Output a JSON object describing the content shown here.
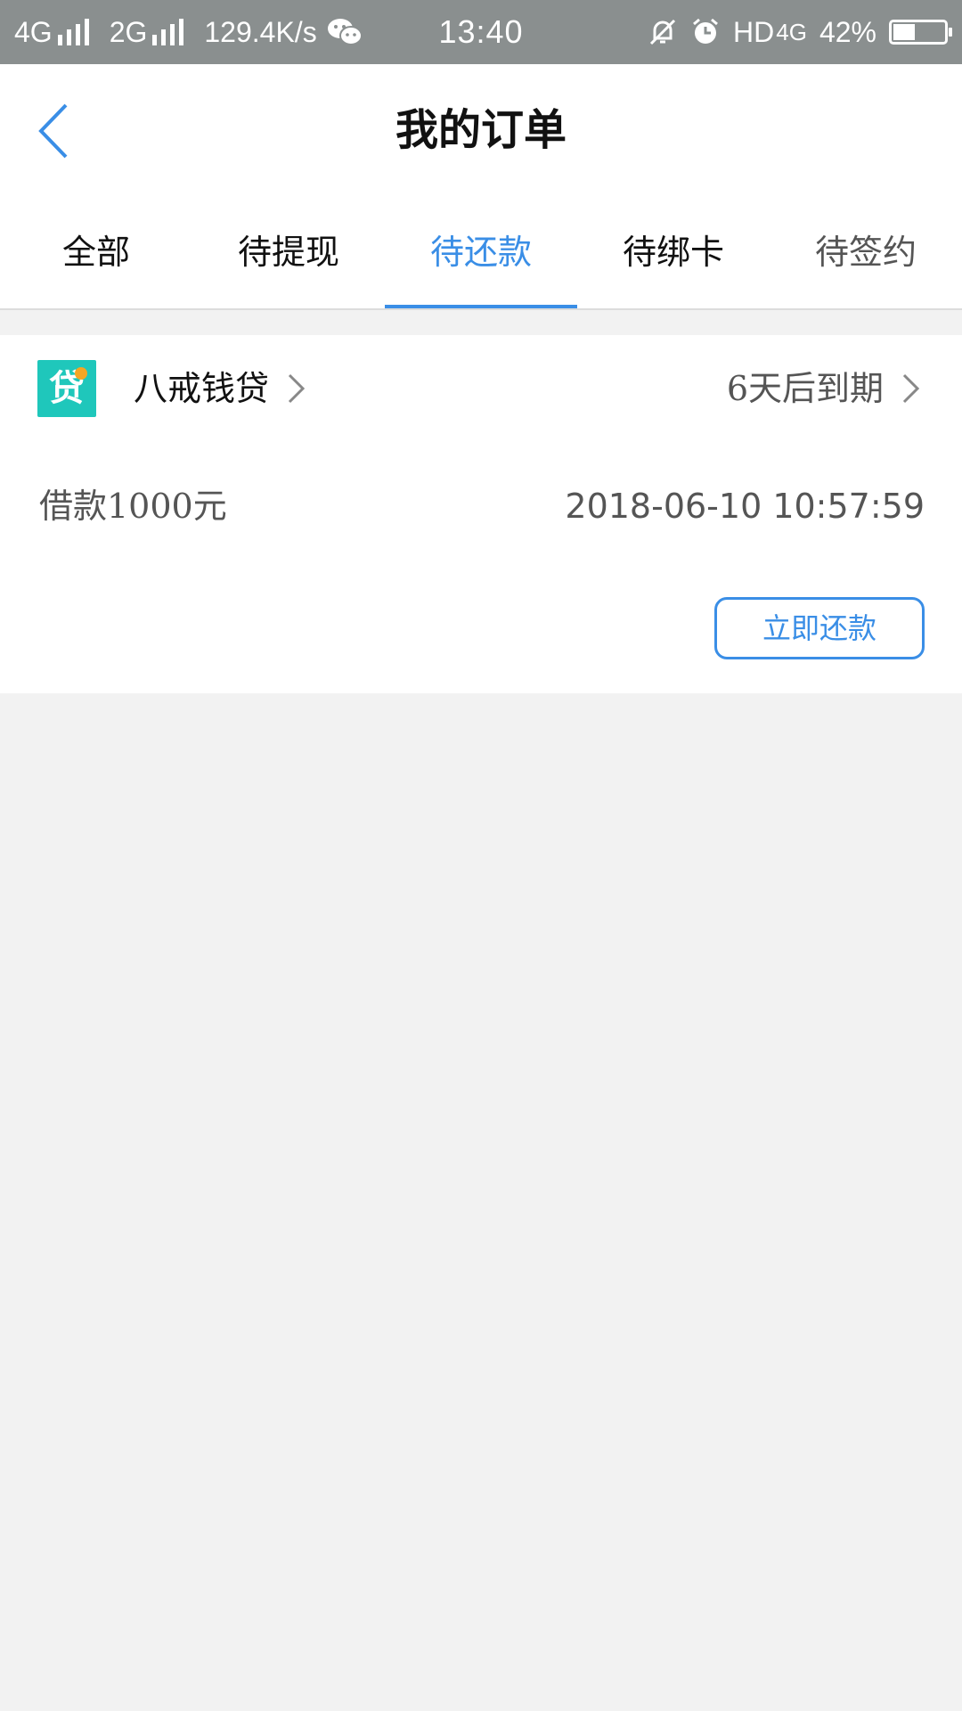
{
  "status_bar": {
    "net1": "4G",
    "net2": "2G",
    "speed": "129.4K/s",
    "time": "13:40",
    "hd": "HD",
    "net3": "4G",
    "battery": "42%",
    "battery_level": 0.42,
    "icons": [
      "signal-icon",
      "wechat-icon",
      "mute-icon",
      "alarm-icon"
    ]
  },
  "header": {
    "title": "我的订单"
  },
  "tabs": [
    {
      "label": "全部"
    },
    {
      "label": "待提现"
    },
    {
      "label": "待还款",
      "active": true
    },
    {
      "label": "待绑卡"
    },
    {
      "label": "待签约"
    }
  ],
  "order": {
    "logo_char": "贷",
    "lender": "八戒钱贷",
    "due": "6天后到期",
    "amount": "借款1000元",
    "datetime": "2018-06-10 10:57:59",
    "repay_label": "立即还款"
  },
  "colors": {
    "accent": "#3a8ee6",
    "logo_bg": "#1fc7bb",
    "status_bar": "#8a8f8f",
    "page_bg": "#f2f2f2"
  }
}
